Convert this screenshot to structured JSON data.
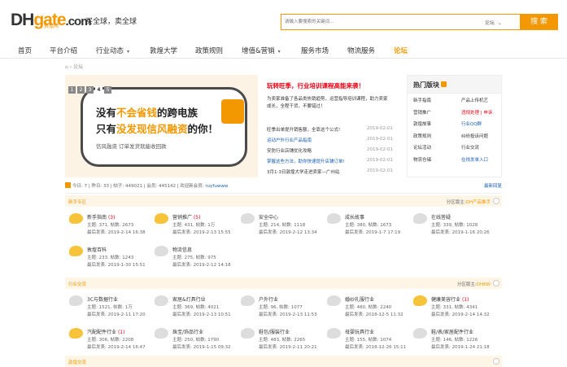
{
  "header": {
    "logo_dh": "DH",
    "logo_gate": "gate",
    "logo_com": ".com",
    "logo_sub": "敦煌网",
    "tagline": "买全球，卖全球",
    "search_placeholder": "请输入要搜索的关键词...",
    "search_scope": "论坛",
    "search_button": "搜 索"
  },
  "nav": {
    "items": [
      "首页",
      "平台介绍",
      "行业动态",
      "敦煌大学",
      "政策规则",
      "增值&营销",
      "服务市场",
      "物流服务",
      "论坛"
    ]
  },
  "breadcrumb": {
    "home": "⌂",
    "sep": "›",
    "current": "论坛"
  },
  "banner": {
    "line1_a": "没有",
    "line1_hl": "不会省钱",
    "line1_b": "的跨电族",
    "line2_a": "只有",
    "line2_hl": "没发现信风融资",
    "line2_b": "的你！",
    "line3": "信风融资 订单发货就能收回款",
    "pages": [
      "1",
      "2",
      "3",
      "4",
      "5"
    ],
    "current_page": "4"
  },
  "news": {
    "headline": "玩转旺季，行业培训课程高能来袭！",
    "desc": "为卖家准备了各品类热销趋势，运营指导培训课程，助力卖家成长，全程干货，不要错过！",
    "items": [
      {
        "title": "旺季出单提升销售额，全靠这个公式!",
        "date": "2019-02-01",
        "link": false
      },
      {
        "title": "运动户外行业产品指南",
        "date": "2019-02-01",
        "link": true
      },
      {
        "title": "安防行业店铺优化攻略",
        "date": "2019-02-01",
        "link": false
      },
      {
        "title": "掌握这些方法，助你快速提升店铺订单!",
        "date": "2019-02-01",
        "link": true
      },
      {
        "title": "3月1-3日敦煌大学走进卖家—广州站",
        "date": "2019-02-01",
        "link": false
      }
    ]
  },
  "hot": {
    "title": "热门版块",
    "rows": [
      {
        "left": "新手指南",
        "right": "产品上传机艺",
        "style": "normal"
      },
      {
        "left": "营销推广",
        "right": "违规处理 | 申诉",
        "style": "red"
      },
      {
        "left": "敦煌故事",
        "right": "行业QQ群",
        "style": "blue"
      },
      {
        "left": "政策规则",
        "right": "纠纷投诉问题",
        "style": "normal"
      },
      {
        "left": "论坛活动",
        "right": "行业交流",
        "style": "normal"
      },
      {
        "left": "物流仓储",
        "right": "在线发单入口",
        "style": "blue"
      }
    ]
  },
  "stats": {
    "text": "今日: 7 | 昨日: 33 | 帖子: 449021 | 会员: 445142 | 欢迎新会员:",
    "last_member": "ruyfuwww",
    "right": "最新回复"
  },
  "sections": [
    {
      "name": "新手专区",
      "mod_label": "分区版主:",
      "mod": "DH产品推手",
      "forums": [
        {
          "name": "新手指南",
          "count": "(3)",
          "stat": "主题: 371, 帖数: 2673",
          "last": "最后发表: 2019-2-14 16:38",
          "new": true
        },
        {
          "name": "营销推广",
          "count": "(5)",
          "stat": "主题: 431, 帖数: 1万",
          "last": "最后发表: 2019-2-13 15:55",
          "new": true
        },
        {
          "name": "安全中心",
          "count": "",
          "stat": "主题: 214, 帖数: 1118",
          "last": "最后发表: 2019-2-12 13:34",
          "new": false
        },
        {
          "name": "成长故事",
          "count": "",
          "stat": "主题: 380, 帖数: 1673",
          "last": "最后发表: 2019-1-7 17:19",
          "new": false
        },
        {
          "name": "在线答疑",
          "count": "",
          "stat": "主题: 339, 帖数: 1028",
          "last": "最后发表: 2019-1-16 20:26",
          "new": false
        },
        {
          "name": "敦煌百科",
          "count": "",
          "stat": "主题: 233, 帖数: 1243",
          "last": "最后发表: 2019-1-30 15:51",
          "new": true
        },
        {
          "name": "物流信息",
          "count": "",
          "stat": "主题: 275, 帖数: 975",
          "last": "最后发表: 2019-2-12 14:18",
          "new": false
        }
      ]
    },
    {
      "name": "行业交流",
      "mod_label": "分区版主:",
      "mod": "DHKW",
      "forums": [
        {
          "name": "3C与数据行业",
          "count": "",
          "stat": "主题: 1521, 帖数: 1万",
          "last": "最后发表: 2019-2-11 17:20",
          "new": false
        },
        {
          "name": "家居&灯具行业",
          "count": "",
          "stat": "主题: 369, 帖数: 4021",
          "last": "最后发表: 2019-2-13 10:51",
          "new": false
        },
        {
          "name": "户外行业",
          "count": "",
          "stat": "主题: 96, 帖数: 1077",
          "last": "最后发表: 2019-2-13 11:53",
          "new": false
        },
        {
          "name": "婚纱礼服行业",
          "count": "",
          "stat": "主题: 480, 帖数: 2240",
          "last": "最后发表: 2018-12-5 11:32",
          "new": false
        },
        {
          "name": "健康美容行业",
          "count": "(1)",
          "stat": "主题: 331, 帖数: 4341",
          "last": "最后发表: 2019-2-14 14:32",
          "new": true
        },
        {
          "name": "汽配配件行业",
          "count": "(1)",
          "stat": "主题: 306, 帖数: 2208",
          "last": "最后发表: 2019-2-14 16:47",
          "new": true
        },
        {
          "name": "珠宝/饰品行业",
          "count": "",
          "stat": "主题: 250, 帖数: 1790",
          "last": "最后发表: 2019-1-15 09:32",
          "new": false
        },
        {
          "name": "鞋包/服装行业",
          "count": "",
          "stat": "主题: 483, 帖数: 2265",
          "last": "最后发表: 2019-2-11 20:21",
          "new": false
        },
        {
          "name": "母婴玩具行业",
          "count": "",
          "stat": "主题: 155, 帖数: 1074",
          "last": "最后发表: 2018-12-26 15:11",
          "new": false
        },
        {
          "name": "鞋/表/家居配件行业",
          "count": "",
          "stat": "主题: 146, 帖数: 1226",
          "last": "最后发表: 2019-1-24 21:18",
          "new": false
        }
      ]
    },
    {
      "name": "敦煌交流",
      "mod_label": "",
      "mod": "",
      "forums": []
    }
  ]
}
